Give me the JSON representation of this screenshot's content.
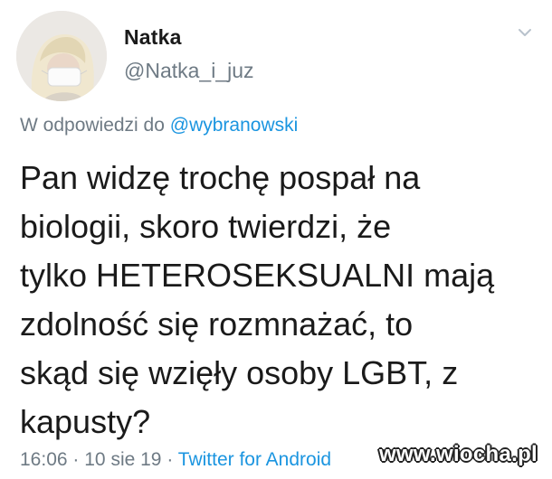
{
  "author": {
    "display_name": "Natka",
    "handle": "@Natka_i_juz"
  },
  "reply": {
    "prefix": "W odpowiedzi do",
    "mention": "@wybranowski"
  },
  "tweet": {
    "lines": [
      "Pan widzę trochę pospał na",
      "biologii, skoro twierdzi, że",
      "tylko HETEROSEKSUALNI mają",
      "zdolność się rozmnażać, to",
      "skąd się wzięły osoby LGBT, z",
      "kapusty?"
    ]
  },
  "meta": {
    "time": "16:06",
    "separator": "·",
    "date": "10 sie 19",
    "source": "Twitter for Android"
  },
  "watermark": {
    "text": "www.wiocha.pl"
  },
  "icons": {
    "caret": "chevron-down-icon",
    "avatar": "profile-photo"
  },
  "colors": {
    "link": "#1b95e0",
    "secondary_text": "#6e7a84",
    "primary_text": "#1a1a1a"
  }
}
